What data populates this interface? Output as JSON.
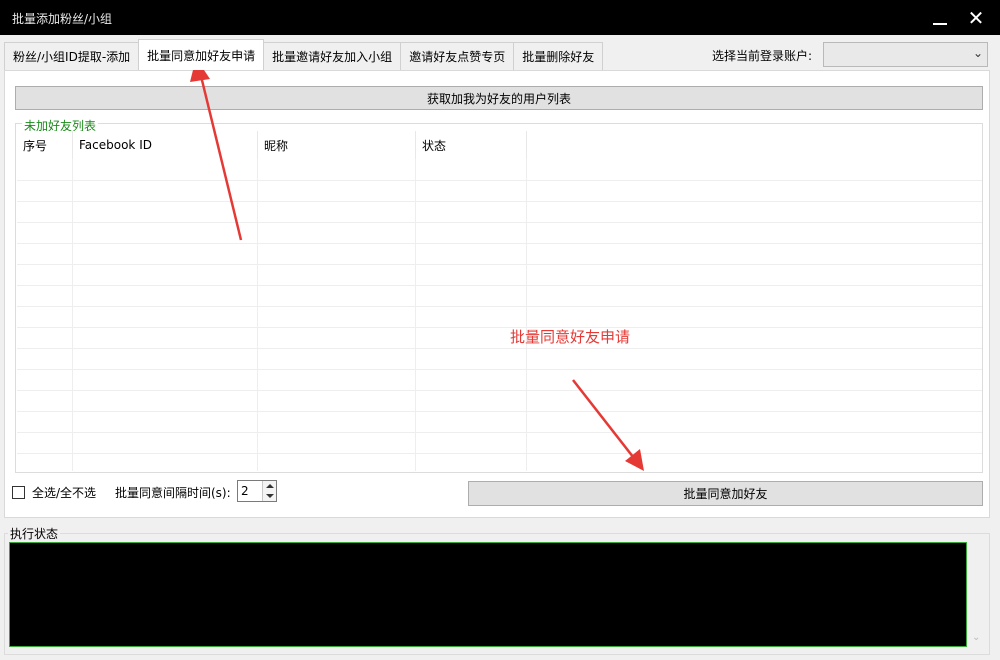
{
  "window": {
    "title": "批量添加粉丝/小组",
    "minimize_icon": "minimize-icon",
    "close_glyph": "✕"
  },
  "tabs": [
    {
      "label": "粉丝/小组ID提取-添加",
      "active": false
    },
    {
      "label": "批量同意加好友申请",
      "active": true
    },
    {
      "label": "批量邀请好友加入小组",
      "active": false
    },
    {
      "label": "邀请好友点赞专页",
      "active": false
    },
    {
      "label": "批量删除好友",
      "active": false
    }
  ],
  "account": {
    "label": "选择当前登录账户:",
    "selected": ""
  },
  "fetch_button": "获取加我为好友的用户列表",
  "group_title": "未加好友列表",
  "table": {
    "columns": [
      "序号",
      "Facebook ID",
      "昵称",
      "状态"
    ],
    "rows": []
  },
  "annotation_text": "批量同意好友申请",
  "select_all_label": "全选/全不选",
  "interval": {
    "label": "批量同意间隔时间(s):",
    "value": "2"
  },
  "accept_button": "批量同意加好友",
  "status_title": "执行状态",
  "colors": {
    "annotation": "#e53935",
    "legend_green": "#1a8a1a",
    "console_bg": "#000000"
  }
}
